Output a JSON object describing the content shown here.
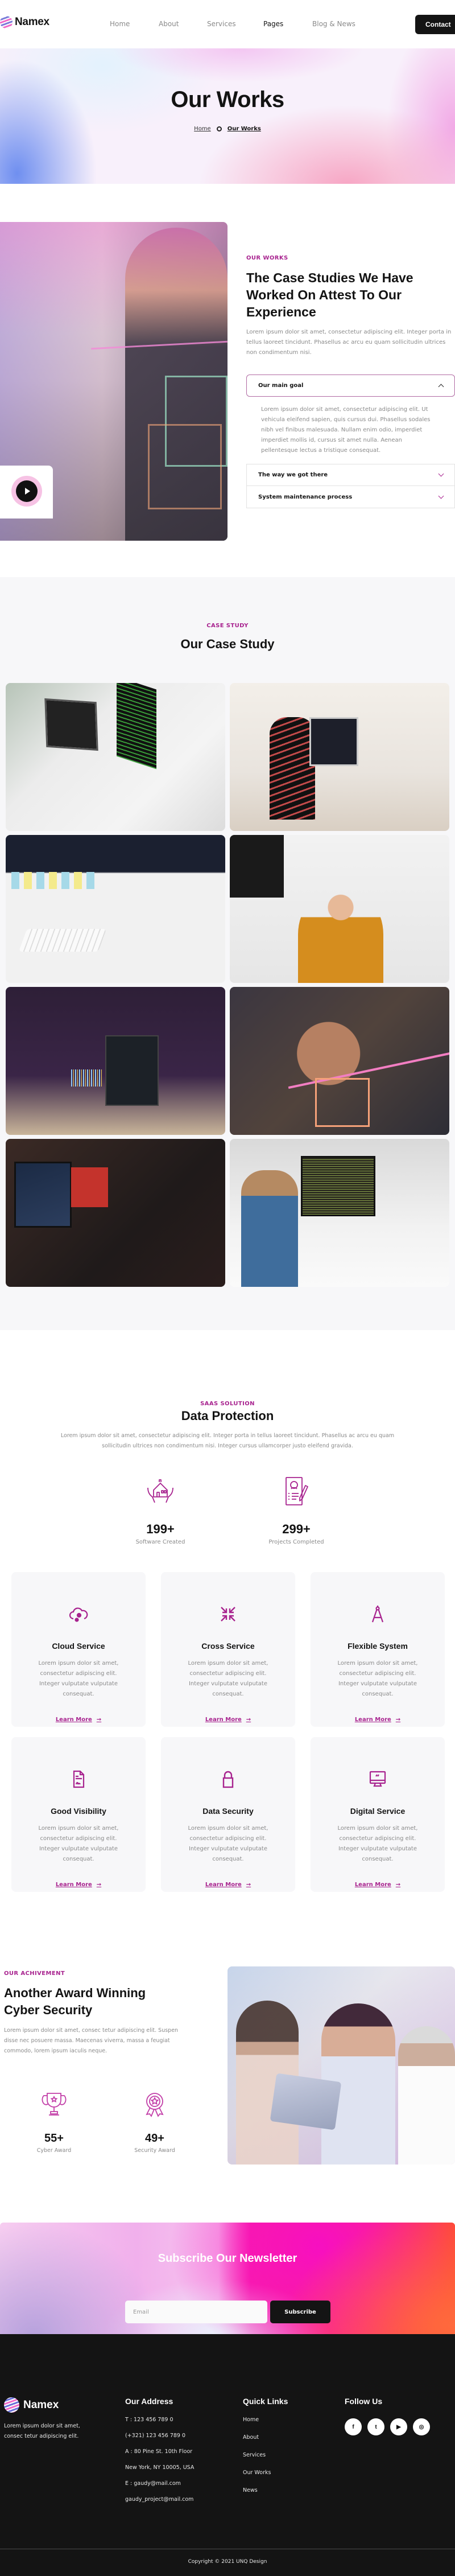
{
  "header": {
    "brand": "Namex",
    "nav": [
      {
        "label": "Home",
        "active": false
      },
      {
        "label": "About",
        "active": false
      },
      {
        "label": "Services",
        "active": false
      },
      {
        "label": "Pages",
        "active": true
      },
      {
        "label": "Blog & News",
        "active": false
      }
    ],
    "contact_label": "Contact"
  },
  "hero": {
    "title": "Our Works",
    "breadcrumb": {
      "home": "Home",
      "current": "Our Works"
    }
  },
  "works": {
    "eyebrow": "OUR WORKS",
    "title": "The Case Studies We Have Worked On Attest To Our Experience",
    "description": "Lorem ipsum dolor sit amet, consectetur adipiscing elit. Integer porta in tellus laoreet tincidunt. Phasellus ac arcu eu quam sollicitudin ultrices non condimentum nisi.",
    "play_label": "play-video",
    "accordion": [
      {
        "title": "Our main goal",
        "open": true,
        "body": "Lorem ipsum dolor sit amet, consectetur adipiscing elit. Ut vehicula eleifend sapien, quis cursus dui. Phasellus sodales nibh vel finibus malesuada. Nullam enim odio, imperdiet imperdiet mollis id, cursus sit amet nulla. Aenean pellentesque lectus a tristique consequat."
      },
      {
        "title": "The way we got there",
        "open": false
      },
      {
        "title": "System maintenance process",
        "open": false
      }
    ]
  },
  "case_study": {
    "eyebrow": "CASE STUDY",
    "title": "Our Case Study",
    "images": [
      {
        "alt": "Developer typing code on a laptop"
      },
      {
        "alt": "Two colleagues reviewing code on a monitor"
      },
      {
        "alt": "Hands on keyboard with sticky notes on monitor"
      },
      {
        "alt": "Smiling developer in yellow sweater"
      },
      {
        "alt": "Multiple monitors showing code and audio waveform"
      },
      {
        "alt": "Two people drawing on glass board"
      },
      {
        "alt": "Trader analyzing stock charts"
      },
      {
        "alt": "Developer viewing code on dual monitors"
      }
    ]
  },
  "data_protection": {
    "eyebrow": "SAAS SOLUTION",
    "title": "Data Protection",
    "description": "Lorem ipsum dolor sit amet, consectetur adipiscing elit. Integer porta in tellus laoreet tincidunt. Phasellus ac arcu eu quam sollicitudin ultrices non condimentum nisi. Integer cursus ullamcorper justo eleifend gravida.",
    "stats": [
      {
        "icon": "house-in-hands-icon",
        "value": "199+",
        "label": "Software Created"
      },
      {
        "icon": "document-profile-icon",
        "value": "299+",
        "label": "Projects Completed"
      }
    ],
    "services": [
      {
        "icon": "cloud-icon",
        "title": "Cloud Service",
        "desc": "Lorem ipsum dolor sit amet, consectetur adipiscing elit. Integer vulputate vulputate consequat.",
        "link": "Learn More"
      },
      {
        "icon": "collapse-arrows-icon",
        "title": "Cross Service",
        "desc": "Lorem ipsum dolor sit amet, consectetur adipiscing elit. Integer vulputate vulputate consequat.",
        "link": "Learn More"
      },
      {
        "icon": "compass-icon",
        "title": "Flexible System",
        "desc": "Lorem ipsum dolor sit amet, consectetur adipiscing elit. Integer vulputate vulputate consequat.",
        "link": "Learn More"
      },
      {
        "icon": "signed-document-icon",
        "title": "Good Visibility",
        "desc": "Lorem ipsum dolor sit amet, consectetur adipiscing elit. Integer vulputate vulputate consequat.",
        "link": "Learn More"
      },
      {
        "icon": "lock-icon",
        "title": "Data Security",
        "desc": "Lorem ipsum dolor sit amet, consectetur adipiscing elit. Integer vulputate vulputate consequat.",
        "link": "Learn More"
      },
      {
        "icon": "monitor-icon",
        "title": "Digital Service",
        "desc": "Lorem ipsum dolor sit amet, consectetur adipiscing elit. Integer vulputate vulputate consequat.",
        "link": "Learn More"
      }
    ],
    "arrow": "→"
  },
  "achievement": {
    "eyebrow": "OUR ACHIVEMENT",
    "title": "Another Award Winning Cyber Security",
    "description": "Lorem ipsum dolor sit amet, consec tetur adipiscing elit. Suspen disse nec posuere massa. Maecenas viverra, massa a feugiat commodo, lorem ipsum iaculis neque.",
    "stats": [
      {
        "icon": "trophy-icon",
        "value": "55+",
        "label": "Cyber Award"
      },
      {
        "icon": "medal-icon",
        "value": "49+",
        "label": "Security Award"
      }
    ]
  },
  "newsletter": {
    "title": "Subscribe Our Newsletter",
    "email_placeholder": "Email",
    "button_label": "Subscribe"
  },
  "footer": {
    "brand": "Namex",
    "about": "Lorem ipsum dolor sit amet, consec tetur adipiscing elit.",
    "address": {
      "heading": "Our Address",
      "lines": [
        "T : 123 456 789 0",
        "(+321) 123 456 789 0",
        "A : 80 Pine St. 10th Floor",
        "New York, NY 10005, USA",
        "E : gaudy@mail.com",
        "gaudy_project@mail.com"
      ]
    },
    "quick_links": {
      "heading": "Quick Links",
      "items": [
        "Home",
        "About",
        "Services",
        "Our Works",
        "News"
      ]
    },
    "follow": {
      "heading": "Follow Us",
      "social": [
        {
          "name": "facebook",
          "glyph": "f"
        },
        {
          "name": "twitter",
          "glyph": "t"
        },
        {
          "name": "youtube",
          "glyph": "▶"
        },
        {
          "name": "instagram",
          "glyph": "◎"
        }
      ]
    },
    "copyright": "Copyright © 2021 UNQ Design"
  },
  "colors": {
    "accent": "#a8238f",
    "dark": "#141414",
    "muted_text": "#8a8a8a",
    "section_bg": "#f7f7f9"
  }
}
